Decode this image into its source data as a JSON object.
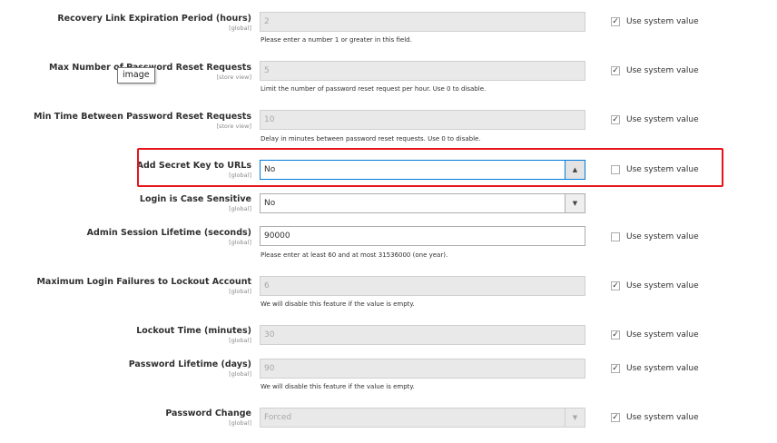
{
  "rows": [
    {
      "label": "Recovery Link Expiration Period (hours)",
      "scope": "[global]",
      "value": "2",
      "note": "Please enter a number 1 or greater in this field.",
      "use_system": true,
      "system_label": "Use system value"
    },
    {
      "label": "Max Number of Password Reset Requests",
      "scope": "[store view]",
      "value": "5",
      "note": "Limit the number of password reset request per hour. Use 0 to disable.",
      "use_system": true,
      "system_label": "Use system value"
    },
    {
      "label": "Min Time Between Password Reset Requests",
      "scope": "[store view]",
      "value": "10",
      "note": "Delay in minutes between password reset requests. Use 0 to disable.",
      "use_system": true,
      "system_label": "Use system value"
    },
    {
      "label": "Add Secret Key to URLs",
      "scope": "[global]",
      "value": "No",
      "use_system": false,
      "system_label": "Use system value"
    },
    {
      "label": "Login is Case Sensitive",
      "scope": "[global]",
      "value": "No"
    },
    {
      "label": "Admin Session Lifetime (seconds)",
      "scope": "[global]",
      "value": "90000",
      "note": "Please enter at least 60 and at most 31536000 (one year).",
      "use_system": false,
      "system_label": "Use system value"
    },
    {
      "label": "Maximum Login Failures to Lockout Account",
      "scope": "[global]",
      "value": "6",
      "note": "We will disable this feature if the value is empty.",
      "use_system": true,
      "system_label": "Use system value"
    },
    {
      "label": "Lockout Time (minutes)",
      "scope": "[global]",
      "value": "30",
      "use_system": true,
      "system_label": "Use system value"
    },
    {
      "label": "Password Lifetime (days)",
      "scope": "[global]",
      "value": "90",
      "note": "We will disable this feature if the value is empty.",
      "use_system": true,
      "system_label": "Use system value"
    },
    {
      "label": "Password Change",
      "scope": "[global]",
      "value": "Forced",
      "use_system": true,
      "system_label": "Use system value"
    }
  ],
  "tooltip": "image",
  "icons": {
    "select_open": "caret-up-icon",
    "select_closed": "caret-down-icon",
    "check": "checkmark-icon"
  },
  "colors": {
    "highlight": "#e8141b",
    "disabled_bg": "#e9e9e9",
    "border": "#adadad"
  }
}
